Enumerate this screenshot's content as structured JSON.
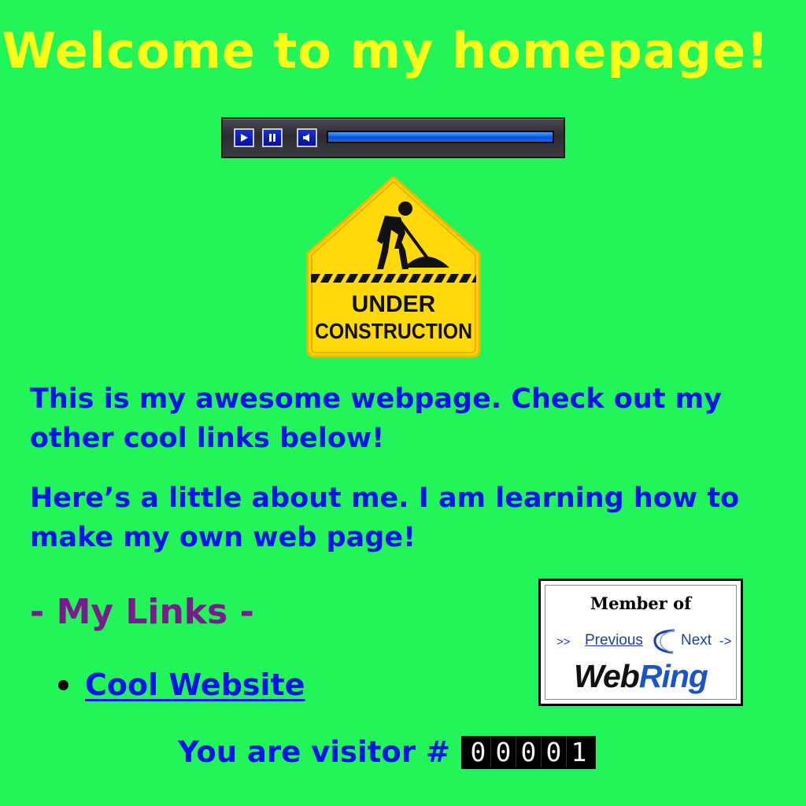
{
  "page": {
    "title": "Welcome to my homepage!",
    "background_color": "#22f55a"
  },
  "player": {
    "play_icon": "play-icon",
    "pause_icon": "pause-icon",
    "mute_icon": "speaker-icon",
    "progress": 1.0
  },
  "sign": {
    "line1": "UNDER",
    "line2": "CONSTRUCTION",
    "icon": "worker-shoveling-icon"
  },
  "content": {
    "paragraph1": "This is my awesome webpage. Check out my other cool links below!",
    "paragraph2": "Here’s a little about me. I am learning how to make my own web page!"
  },
  "links": {
    "heading": "- My Links -",
    "items": [
      {
        "label": "Cool Website"
      }
    ]
  },
  "webring": {
    "member_text": "Member of",
    "arrows_left": ">>",
    "previous_label": "Previous",
    "next_label": "Next",
    "arrow_right": "->",
    "logo_web": "Web",
    "logo_ring": "Ring"
  },
  "visitor": {
    "label": "You are visitor #",
    "digits": [
      "0",
      "0",
      "0",
      "0",
      "1"
    ]
  },
  "colors": {
    "title": "#ffff1a",
    "body_text": "#0a14ea",
    "heading": "#7a1a8c",
    "sign_yellow": "#ffd500"
  }
}
